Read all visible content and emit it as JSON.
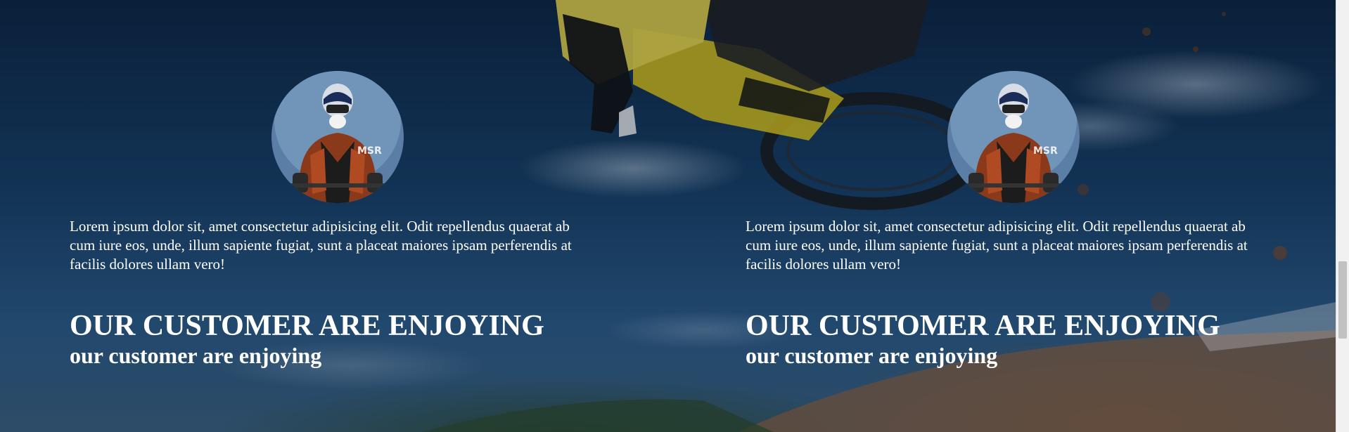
{
  "colors": {
    "sky": "#173f66",
    "text": "#ffffff",
    "scrollbar_track": "#f1f1f1",
    "scrollbar_thumb": "#c1c1c1"
  },
  "hero": {
    "background_icon": "motocross-rider-jump-photo"
  },
  "testimonials": [
    {
      "avatar_icon": "motocross-rider-avatar",
      "text": "Lorem ipsum dolor sit, amet consectetur adipisicing elit. Odit repellendus quaerat ab cum iure eos, unde, illum sapiente fugiat, sunt a placeat maiores ipsam perferendis at facilis dolores ullam vero!",
      "title": "OUR CUSTOMER ARE ENJOYING",
      "subtitle": "our customer are enjoying"
    },
    {
      "avatar_icon": "motocross-rider-avatar",
      "text": "Lorem ipsum dolor sit, amet consectetur adipisicing elit. Odit repellendus quaerat ab cum iure eos, unde, illum sapiente fugiat, sunt a placeat maiores ipsam perferendis at facilis dolores ullam vero!",
      "title": "OUR CUSTOMER ARE ENJOYING",
      "subtitle": "our customer are enjoying"
    }
  ]
}
